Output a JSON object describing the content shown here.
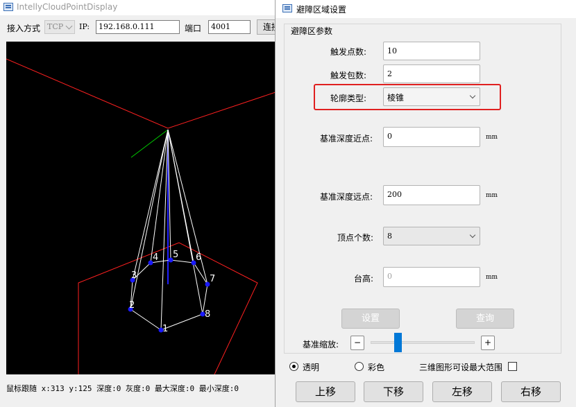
{
  "main": {
    "title": "IntellyCloudPointDisplay",
    "connection": {
      "access_label": "接入方式",
      "protocol": "TCP",
      "ip_label": "IP:",
      "ip_value": "192.168.0.111",
      "port_label": "端口",
      "port_value": "4001",
      "connect_label": "连接"
    },
    "viewer": {
      "vertex_labels": [
        "1",
        "2",
        "3",
        "4",
        "5",
        "6",
        "7",
        "8"
      ]
    },
    "status": "鼠标跟随 x:313 y:125 深度:0 灰度:0 最大深度:0 最小深度:0"
  },
  "dialog": {
    "title": "避障区域设置",
    "group_title": "避障区参数",
    "fields": {
      "trigger_points_label": "触发点数:",
      "trigger_points_value": "10",
      "trigger_packets_label": "触发包数:",
      "trigger_packets_value": "2",
      "profile_type_label": "轮廓类型:",
      "profile_type_value": "棱锥",
      "near_depth_label": "基准深度近点:",
      "near_depth_value": "0",
      "near_depth_unit": "mm",
      "far_depth_label": "基准深度远点:",
      "far_depth_value": "200",
      "far_depth_unit": "mm",
      "vertex_count_label": "顶点个数:",
      "vertex_count_value": "8",
      "platform_height_label": "台高:",
      "platform_height_value": "0",
      "platform_height_unit": "mm"
    },
    "buttons": {
      "set_label": "设置",
      "query_label": "查询"
    },
    "zoom": {
      "label": "基准缩放:",
      "minus": "−",
      "plus": "+",
      "value_fraction": 0.26
    },
    "display": {
      "transparent_label": "透明",
      "color_label": "彩色",
      "max_range_label": "三维图形可设最大范围"
    },
    "move": {
      "up": "上移",
      "down": "下移",
      "left": "左移",
      "right": "右移"
    }
  },
  "colors": {
    "highlight": "#e02020",
    "slider": "#0078d7",
    "vertex": "#1a1aff",
    "frame": "#ff2020"
  }
}
